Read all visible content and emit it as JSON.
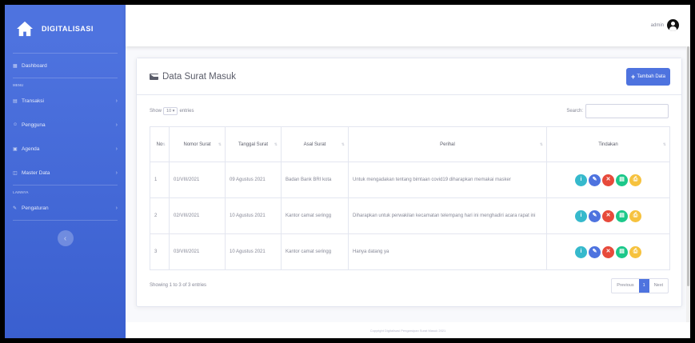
{
  "app": {
    "brand": "DIGITALISASI",
    "user_name": "admin"
  },
  "sidebar": {
    "dashboard": "Dashboard",
    "heading1": "MENU",
    "items": [
      {
        "label": "Transaksi"
      },
      {
        "label": "Pengguna"
      },
      {
        "label": "Agenda"
      },
      {
        "label": "Master Data"
      }
    ],
    "heading2": "LAINNYA",
    "pengaturan": "Pengaturan"
  },
  "page": {
    "title": "Data Surat Masuk",
    "add_button": "Tambah Data",
    "show_label": "Show",
    "show_value": "10",
    "entries_label": "entries",
    "search_label": "Search:",
    "search_value": ""
  },
  "table": {
    "headers": [
      "No",
      "Nomor Surat",
      "Tanggal Surat",
      "Asal Surat",
      "Perihal",
      "Tindakan"
    ],
    "rows": [
      {
        "no": "1",
        "nomor": "01/VIII/2021",
        "tanggal": "09 Agustus 2021",
        "asal": "Badan Bank BRI kota",
        "perihal": "Untuk mengadakan tentang bimtaan covid19 diharapkan memakai masker"
      },
      {
        "no": "2",
        "nomor": "02/VIII/2021",
        "tanggal": "10 Agustus 2021",
        "asal": "Kantor camat seringg",
        "perihal": "Diharapkan untuk perwakilan kecamatan telempang hari ini menghadiri acara rapat ini"
      },
      {
        "no": "3",
        "nomor": "03/VIII/2021",
        "tanggal": "10 Agustus 2021",
        "asal": "Kantor camat seringg",
        "perihal": "Hanya datang ya"
      }
    ]
  },
  "info_text": "Showing 1 to 3 of 3 entries",
  "pagination": {
    "previous": "Previous",
    "current": "1",
    "next": "Next"
  },
  "footer_text": "Copyright Digitalisasi Pengarsipan Surat Masuk 2021",
  "colors": {
    "primary": "#4e73df",
    "action_info": "#36b9cc",
    "action_edit": "#4e73df",
    "action_delete": "#e74a3b",
    "action_success": "#1cc88a",
    "action_warning": "#f6c23e"
  }
}
